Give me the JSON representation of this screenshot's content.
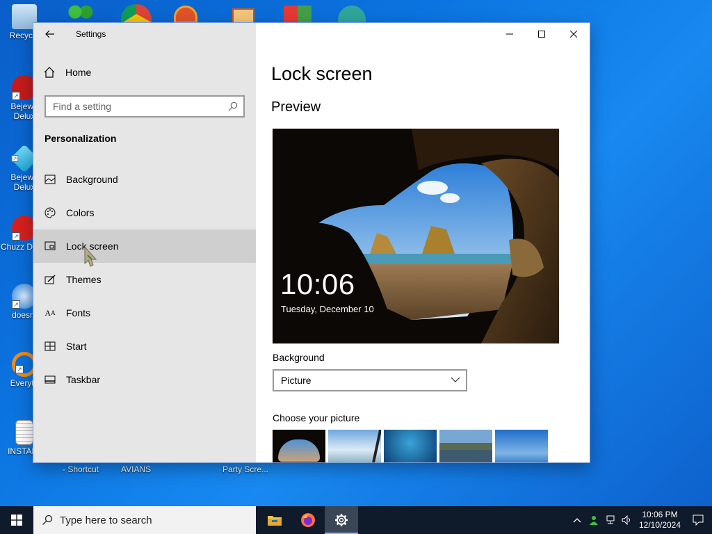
{
  "desktop": {
    "icons": [
      {
        "name": "recycle-bin",
        "label": "Recycle"
      },
      {
        "name": "bejeweled-1",
        "label": "Bejewe Delux"
      },
      {
        "name": "bejeweled-2",
        "label": "Bejewe Delux"
      },
      {
        "name": "chuzzle",
        "label": "Chuzz Delux"
      },
      {
        "name": "doesnt",
        "label": "doesnt"
      },
      {
        "name": "everything",
        "label": "Everyth"
      },
      {
        "name": "install",
        "label": "INSTALL"
      }
    ],
    "bottom_labels": [
      "- Shortcut",
      "AVIANS",
      "Party Scre..."
    ]
  },
  "window": {
    "app_title": "Settings",
    "controls": {
      "minimize": "minimize",
      "maximize": "maximize",
      "close": "close"
    }
  },
  "sidebar": {
    "home_label": "Home",
    "search_placeholder": "Find a setting",
    "section_title": "Personalization",
    "items": [
      {
        "label": "Background",
        "icon": "picture-icon"
      },
      {
        "label": "Colors",
        "icon": "palette-icon"
      },
      {
        "label": "Lock screen",
        "icon": "lock-screen-icon",
        "selected": true
      },
      {
        "label": "Themes",
        "icon": "themes-brush-icon"
      },
      {
        "label": "Fonts",
        "icon": "fonts-icon"
      },
      {
        "label": "Start",
        "icon": "start-icon"
      },
      {
        "label": "Taskbar",
        "icon": "taskbar-icon"
      }
    ]
  },
  "main": {
    "page_title": "Lock screen",
    "preview_label": "Preview",
    "preview_time": "10:06",
    "preview_date": "Tuesday, December 10",
    "background_label": "Background",
    "background_value": "Picture",
    "choose_label": "Choose your picture",
    "thumbnails": [
      "cave-beach",
      "pier-sky",
      "underwater",
      "mountain-lake",
      "blue-horizon"
    ]
  },
  "taskbar": {
    "search_placeholder": "Type here to search",
    "apps": [
      "file-explorer",
      "firefox",
      "settings"
    ],
    "clock_time": "10:06 PM",
    "clock_date": "12/10/2024"
  },
  "colors": {
    "accent": "#0078d7",
    "sidebar_bg": "#e6e6e6",
    "selected_item": "#cfcfcf",
    "taskbar_bg": "#0f1a2a"
  }
}
